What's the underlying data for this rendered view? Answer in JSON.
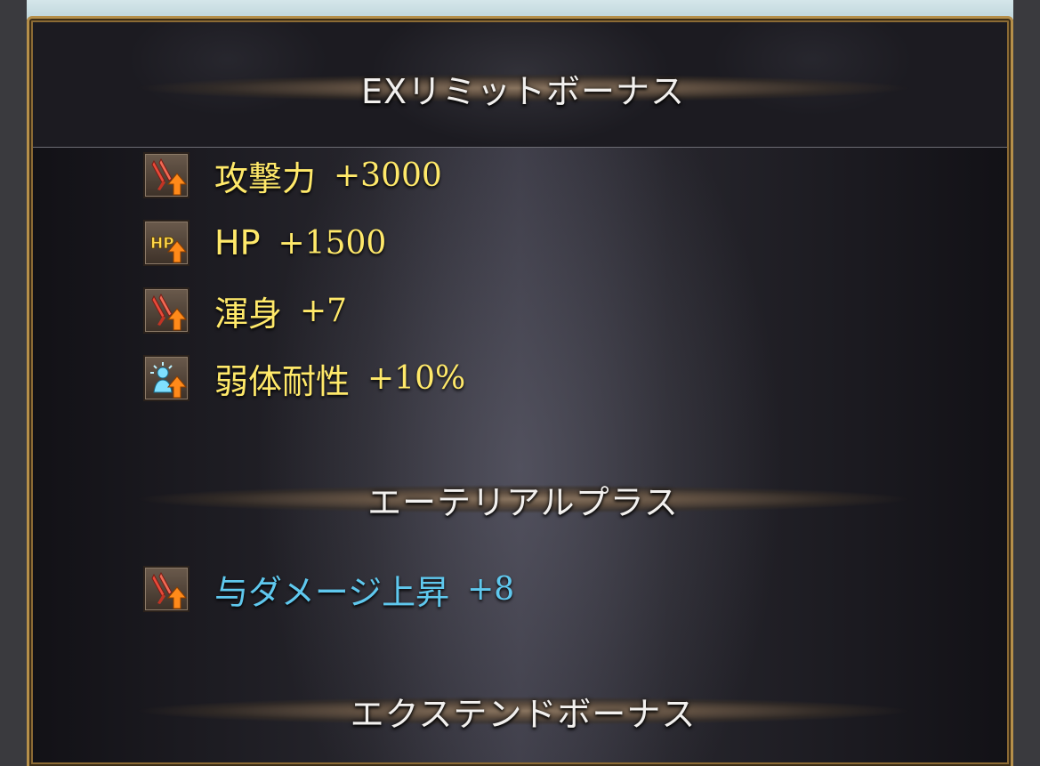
{
  "sections": [
    {
      "title": "EXリミットボーナス"
    },
    {
      "title": "エーテリアルプラス"
    },
    {
      "title": "エクステンドボーナス"
    }
  ],
  "ex_limit_bonuses": [
    {
      "icon": "attack-up-icon",
      "name": "攻撃力",
      "value": "+3000"
    },
    {
      "icon": "hp-up-icon",
      "name": "HP",
      "value": "+1500"
    },
    {
      "icon": "attack-up-icon",
      "name": "渾身",
      "value": "+7"
    },
    {
      "icon": "debuff-resist-up-icon",
      "name": "弱体耐性",
      "value": "+10%"
    }
  ],
  "ethereal_plus": [
    {
      "icon": "attack-up-icon",
      "name": "与ダメージ上昇",
      "value": "+8"
    }
  ],
  "colors": {
    "stat_yellow": "#ffe96a",
    "stat_blue": "#5fc8ee",
    "frame_gold": "#b58f4a"
  }
}
